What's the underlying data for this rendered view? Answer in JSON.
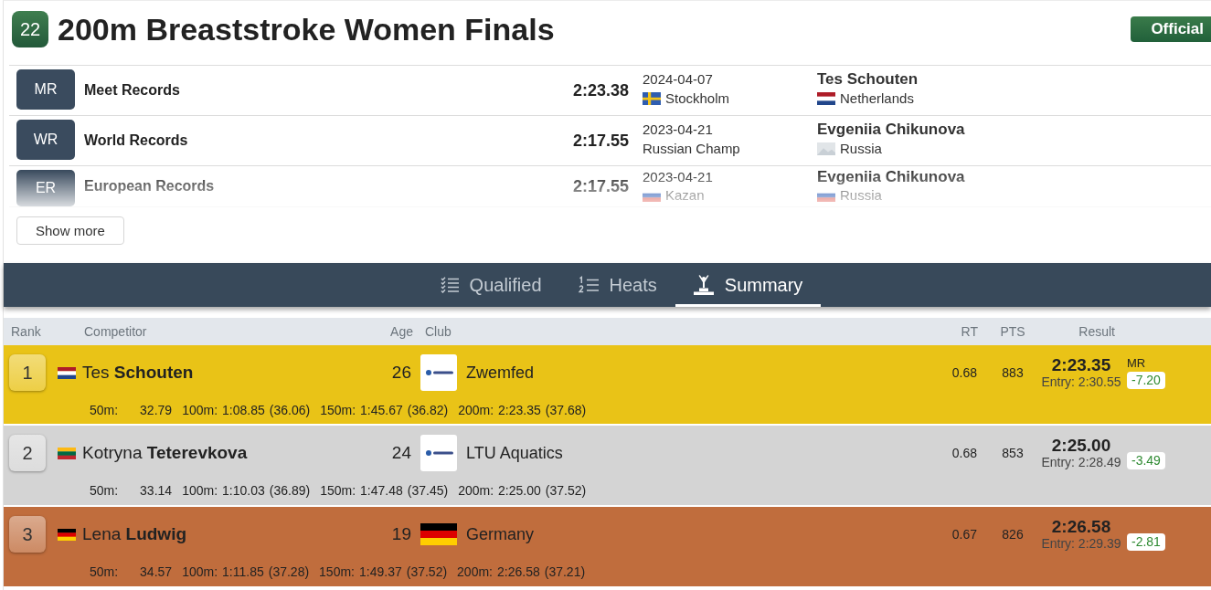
{
  "event": {
    "number": "22",
    "title": "200m Breaststroke Women Finals",
    "status": "Official"
  },
  "records": [
    {
      "code": "MR",
      "name": "Meet Records",
      "time": "2:23.38",
      "date": "2024-04-07",
      "place": "Stockholm",
      "place_flag": {
        "kind": "sweden"
      },
      "holder": "Tes Schouten",
      "country": "Netherlands",
      "country_flag": {
        "kind": "netherlands"
      },
      "faded": false
    },
    {
      "code": "WR",
      "name": "World Records",
      "time": "2:17.55",
      "date": "2023-04-21",
      "place": "Russian Champ",
      "holder": "Evgeniia Chikunova",
      "country": "Russia",
      "country_flag": {
        "kind": "placeholder"
      },
      "faded": false
    },
    {
      "code": "ER",
      "name": "European Records",
      "time": "2:17.55",
      "date": "2023-04-21",
      "place": "Kazan",
      "place_flag": {
        "kind": "russia"
      },
      "holder": "Evgeniia Chikunova",
      "country": "Russia",
      "country_flag": {
        "kind": "russia"
      },
      "faded": true
    }
  ],
  "show_more": "Show more",
  "tabs": [
    {
      "label": "Qualified",
      "selected": false
    },
    {
      "label": "Heats",
      "selected": false
    },
    {
      "label": "Summary",
      "selected": true
    }
  ],
  "table": {
    "columns": [
      "Rank",
      "Competitor",
      "Age",
      "Club",
      "RT",
      "PTS",
      "Result"
    ],
    "rows": [
      {
        "rank": "1",
        "color": "#e9c317",
        "flag": {
          "kind": "netherlands"
        },
        "name": "Tes **Schouten**",
        "age": "26",
        "club_logo": {
          "kind": "logo"
        },
        "club": "Zwemfed",
        "rt": "0.68",
        "pts": "883",
        "result": "2:23.35",
        "entry": "Entry: 2:30.55",
        "record": "MR",
        "diff": "-7.20",
        "splits": [
          {
            "distance": "50m:",
            "time": "32.79"
          },
          {
            "distance": "100m:",
            "time": "1:08.85",
            "lap": "(36.06)"
          },
          {
            "distance": "150m:",
            "time": "1:45.67",
            "lap": "(36.82)"
          },
          {
            "distance": "200m:",
            "time": "2:23.35",
            "lap": "(37.68)"
          }
        ]
      },
      {
        "rank": "2",
        "color": "#d4d4d4",
        "flag": {
          "kind": "lithuania"
        },
        "name": "Kotryna **Teterevkova**",
        "age": "24",
        "club_logo": {
          "kind": "logo"
        },
        "club": "LTU Aquatics",
        "rt": "0.68",
        "pts": "853",
        "result": "2:25.00",
        "entry": "Entry: 2:28.49",
        "diff": "-3.49",
        "splits": [
          {
            "distance": "50m:",
            "time": "33.14"
          },
          {
            "distance": "100m:",
            "time": "1:10.03",
            "lap": "(36.89)"
          },
          {
            "distance": "150m:",
            "time": "1:47.48",
            "lap": "(37.45)"
          },
          {
            "distance": "200m:",
            "time": "2:25.00",
            "lap": "(37.52)"
          }
        ]
      },
      {
        "rank": "3",
        "color": "#c06d3d",
        "flag": {
          "kind": "germany"
        },
        "name": "Lena **Ludwig**",
        "age": "19",
        "club_logo": {
          "kind": "germany"
        },
        "club": "Germany",
        "rt": "0.67",
        "pts": "826",
        "result": "2:26.58",
        "entry": "Entry: 2:29.39",
        "diff": "-2.81",
        "splits": [
          {
            "distance": "50m:",
            "time": "34.57"
          },
          {
            "distance": "100m:",
            "time": "1:11.85",
            "lap": "(37.28)"
          },
          {
            "distance": "150m:",
            "time": "1:49.37",
            "lap": "(37.52)"
          },
          {
            "distance": "200m:",
            "time": "2:26.58",
            "lap": "(37.21)"
          }
        ]
      }
    ]
  }
}
